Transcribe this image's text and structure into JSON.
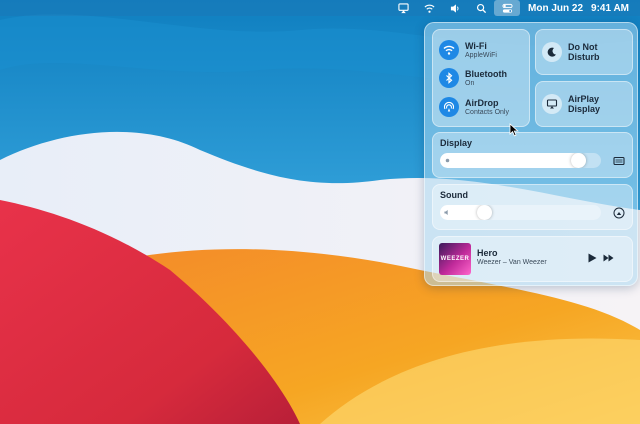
{
  "menubar": {
    "icons": [
      "airplay-icon",
      "wifi-icon",
      "volume-icon",
      "search-icon",
      "control-center-icon"
    ],
    "date": "Mon Jun 22",
    "time": "9:41 AM"
  },
  "control_center": {
    "wifi": {
      "title": "Wi-Fi",
      "subtitle": "AppleWiFi"
    },
    "bluetooth": {
      "title": "Bluetooth",
      "subtitle": "On"
    },
    "airdrop": {
      "title": "AirDrop",
      "subtitle": "Contacts Only"
    },
    "dnd": {
      "title_line1": "Do Not",
      "title_line2": "Disturb"
    },
    "airplay": {
      "title_line1": "AirPlay",
      "title_line2": "Display"
    },
    "display": {
      "label": "Display",
      "level": 0.9
    },
    "sound": {
      "label": "Sound",
      "level": 0.25
    },
    "now_playing": {
      "title": "Hero",
      "artist": "Weezer – Van Weezer",
      "album_text": "WEEZER"
    }
  },
  "colors": {
    "accent": "#1e88e5"
  }
}
